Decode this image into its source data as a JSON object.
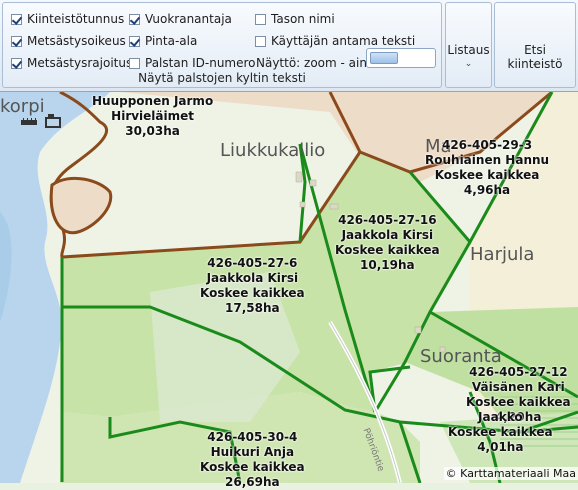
{
  "ribbon": {
    "group_display": {
      "title": "Näytä palstojen kyltin teksti",
      "checkboxes": [
        {
          "label": "Kiinteistötunnus",
          "checked": true
        },
        {
          "label": "Metsästysoikeus",
          "checked": true
        },
        {
          "label": "Metsästysrajoitus",
          "checked": true
        },
        {
          "label": "Vuokranantaja",
          "checked": true
        },
        {
          "label": "Pinta-ala",
          "checked": true
        },
        {
          "label": "Palstan ID-numero",
          "checked": false
        },
        {
          "label": "Tason nimi",
          "checked": false
        },
        {
          "label": "Käyttäjän antama teksti",
          "checked": false
        }
      ],
      "zoom_label": "Näyttö: zoom - aina"
    },
    "listing_button": "Listaus",
    "find_property_button": "Etsi kiinteistö"
  },
  "map": {
    "place_names": {
      "liukkukallio": "Liukkukallio",
      "harjula": "Harjula",
      "suoranta": "Suoranta",
      "korpi": "korpi",
      "ma": "Ma"
    },
    "parcels": {
      "huupponen": [
        "Huupponen Jarmo",
        "Hirvieläimet",
        "30,03ha"
      ],
      "p29_3": [
        "426-405-29-3",
        "Rouhiainen Hannu",
        "Koskee kaikkea",
        "4,96ha"
      ],
      "p27_16": [
        "426-405-27-16",
        "Jaakkola Kirsi",
        "Koskee kaikkea",
        "10,19ha"
      ],
      "p27_6": [
        "426-405-27-6",
        "Jaakkola Kirsi",
        "Koskee kaikkea",
        "17,58ha"
      ],
      "p27_12": [
        "426-405-27-12",
        "Väisänen Kari",
        "Koskee kaikkea",
        "4,29ha"
      ],
      "jaakk": [
        "Jaakko",
        "Koskee kaikkea",
        "4,01ha"
      ],
      "p30_4": [
        "426-405-30-4",
        "Huikuri Anja",
        "Koskee kaikkea",
        "26,69ha"
      ]
    },
    "road_label": "Pöhriöntie",
    "copyright": "© Karttamateriaali Maa"
  },
  "colors": {
    "parcel_border": "#1a8a1a",
    "restricted_border": "#8a4b1a",
    "water": "#b9d6ee",
    "forest": "#c6e2a6"
  }
}
